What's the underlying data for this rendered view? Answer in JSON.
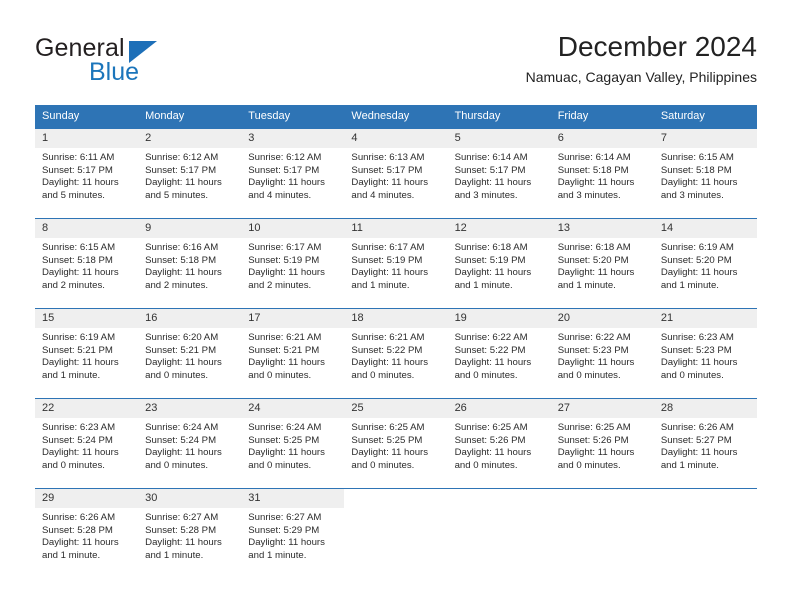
{
  "brand": {
    "name_part1": "General",
    "name_part2": "Blue",
    "triangle_color": "#1d6fb8",
    "blue_color": "#1b75bb"
  },
  "header": {
    "title": "December 2024",
    "subtitle": "Namuac, Cagayan Valley, Philippines"
  },
  "theme": {
    "header_bg": "#2e74b5",
    "daynum_bg": "#efefef",
    "row_rule": "#2e74b5"
  },
  "weekdays": [
    "Sunday",
    "Monday",
    "Tuesday",
    "Wednesday",
    "Thursday",
    "Friday",
    "Saturday"
  ],
  "labels": {
    "sunrise_prefix": "Sunrise:",
    "sunset_prefix": "Sunset:",
    "daylight_prefix": "Daylight:"
  },
  "weeks": [
    [
      {
        "day": "1",
        "sunrise": "Sunrise: 6:11 AM",
        "sunset": "Sunset: 5:17 PM",
        "daylight_line1": "Daylight: 11 hours",
        "daylight_line2": "and 5 minutes."
      },
      {
        "day": "2",
        "sunrise": "Sunrise: 6:12 AM",
        "sunset": "Sunset: 5:17 PM",
        "daylight_line1": "Daylight: 11 hours",
        "daylight_line2": "and 5 minutes."
      },
      {
        "day": "3",
        "sunrise": "Sunrise: 6:12 AM",
        "sunset": "Sunset: 5:17 PM",
        "daylight_line1": "Daylight: 11 hours",
        "daylight_line2": "and 4 minutes."
      },
      {
        "day": "4",
        "sunrise": "Sunrise: 6:13 AM",
        "sunset": "Sunset: 5:17 PM",
        "daylight_line1": "Daylight: 11 hours",
        "daylight_line2": "and 4 minutes."
      },
      {
        "day": "5",
        "sunrise": "Sunrise: 6:14 AM",
        "sunset": "Sunset: 5:17 PM",
        "daylight_line1": "Daylight: 11 hours",
        "daylight_line2": "and 3 minutes."
      },
      {
        "day": "6",
        "sunrise": "Sunrise: 6:14 AM",
        "sunset": "Sunset: 5:18 PM",
        "daylight_line1": "Daylight: 11 hours",
        "daylight_line2": "and 3 minutes."
      },
      {
        "day": "7",
        "sunrise": "Sunrise: 6:15 AM",
        "sunset": "Sunset: 5:18 PM",
        "daylight_line1": "Daylight: 11 hours",
        "daylight_line2": "and 3 minutes."
      }
    ],
    [
      {
        "day": "8",
        "sunrise": "Sunrise: 6:15 AM",
        "sunset": "Sunset: 5:18 PM",
        "daylight_line1": "Daylight: 11 hours",
        "daylight_line2": "and 2 minutes."
      },
      {
        "day": "9",
        "sunrise": "Sunrise: 6:16 AM",
        "sunset": "Sunset: 5:18 PM",
        "daylight_line1": "Daylight: 11 hours",
        "daylight_line2": "and 2 minutes."
      },
      {
        "day": "10",
        "sunrise": "Sunrise: 6:17 AM",
        "sunset": "Sunset: 5:19 PM",
        "daylight_line1": "Daylight: 11 hours",
        "daylight_line2": "and 2 minutes."
      },
      {
        "day": "11",
        "sunrise": "Sunrise: 6:17 AM",
        "sunset": "Sunset: 5:19 PM",
        "daylight_line1": "Daylight: 11 hours",
        "daylight_line2": "and 1 minute."
      },
      {
        "day": "12",
        "sunrise": "Sunrise: 6:18 AM",
        "sunset": "Sunset: 5:19 PM",
        "daylight_line1": "Daylight: 11 hours",
        "daylight_line2": "and 1 minute."
      },
      {
        "day": "13",
        "sunrise": "Sunrise: 6:18 AM",
        "sunset": "Sunset: 5:20 PM",
        "daylight_line1": "Daylight: 11 hours",
        "daylight_line2": "and 1 minute."
      },
      {
        "day": "14",
        "sunrise": "Sunrise: 6:19 AM",
        "sunset": "Sunset: 5:20 PM",
        "daylight_line1": "Daylight: 11 hours",
        "daylight_line2": "and 1 minute."
      }
    ],
    [
      {
        "day": "15",
        "sunrise": "Sunrise: 6:19 AM",
        "sunset": "Sunset: 5:21 PM",
        "daylight_line1": "Daylight: 11 hours",
        "daylight_line2": "and 1 minute."
      },
      {
        "day": "16",
        "sunrise": "Sunrise: 6:20 AM",
        "sunset": "Sunset: 5:21 PM",
        "daylight_line1": "Daylight: 11 hours",
        "daylight_line2": "and 0 minutes."
      },
      {
        "day": "17",
        "sunrise": "Sunrise: 6:21 AM",
        "sunset": "Sunset: 5:21 PM",
        "daylight_line1": "Daylight: 11 hours",
        "daylight_line2": "and 0 minutes."
      },
      {
        "day": "18",
        "sunrise": "Sunrise: 6:21 AM",
        "sunset": "Sunset: 5:22 PM",
        "daylight_line1": "Daylight: 11 hours",
        "daylight_line2": "and 0 minutes."
      },
      {
        "day": "19",
        "sunrise": "Sunrise: 6:22 AM",
        "sunset": "Sunset: 5:22 PM",
        "daylight_line1": "Daylight: 11 hours",
        "daylight_line2": "and 0 minutes."
      },
      {
        "day": "20",
        "sunrise": "Sunrise: 6:22 AM",
        "sunset": "Sunset: 5:23 PM",
        "daylight_line1": "Daylight: 11 hours",
        "daylight_line2": "and 0 minutes."
      },
      {
        "day": "21",
        "sunrise": "Sunrise: 6:23 AM",
        "sunset": "Sunset: 5:23 PM",
        "daylight_line1": "Daylight: 11 hours",
        "daylight_line2": "and 0 minutes."
      }
    ],
    [
      {
        "day": "22",
        "sunrise": "Sunrise: 6:23 AM",
        "sunset": "Sunset: 5:24 PM",
        "daylight_line1": "Daylight: 11 hours",
        "daylight_line2": "and 0 minutes."
      },
      {
        "day": "23",
        "sunrise": "Sunrise: 6:24 AM",
        "sunset": "Sunset: 5:24 PM",
        "daylight_line1": "Daylight: 11 hours",
        "daylight_line2": "and 0 minutes."
      },
      {
        "day": "24",
        "sunrise": "Sunrise: 6:24 AM",
        "sunset": "Sunset: 5:25 PM",
        "daylight_line1": "Daylight: 11 hours",
        "daylight_line2": "and 0 minutes."
      },
      {
        "day": "25",
        "sunrise": "Sunrise: 6:25 AM",
        "sunset": "Sunset: 5:25 PM",
        "daylight_line1": "Daylight: 11 hours",
        "daylight_line2": "and 0 minutes."
      },
      {
        "day": "26",
        "sunrise": "Sunrise: 6:25 AM",
        "sunset": "Sunset: 5:26 PM",
        "daylight_line1": "Daylight: 11 hours",
        "daylight_line2": "and 0 minutes."
      },
      {
        "day": "27",
        "sunrise": "Sunrise: 6:25 AM",
        "sunset": "Sunset: 5:26 PM",
        "daylight_line1": "Daylight: 11 hours",
        "daylight_line2": "and 0 minutes."
      },
      {
        "day": "28",
        "sunrise": "Sunrise: 6:26 AM",
        "sunset": "Sunset: 5:27 PM",
        "daylight_line1": "Daylight: 11 hours",
        "daylight_line2": "and 1 minute."
      }
    ],
    [
      {
        "day": "29",
        "sunrise": "Sunrise: 6:26 AM",
        "sunset": "Sunset: 5:28 PM",
        "daylight_line1": "Daylight: 11 hours",
        "daylight_line2": "and 1 minute."
      },
      {
        "day": "30",
        "sunrise": "Sunrise: 6:27 AM",
        "sunset": "Sunset: 5:28 PM",
        "daylight_line1": "Daylight: 11 hours",
        "daylight_line2": "and 1 minute."
      },
      {
        "day": "31",
        "sunrise": "Sunrise: 6:27 AM",
        "sunset": "Sunset: 5:29 PM",
        "daylight_line1": "Daylight: 11 hours",
        "daylight_line2": "and 1 minute."
      },
      {
        "day": "",
        "sunrise": "",
        "sunset": "",
        "daylight_line1": "",
        "daylight_line2": ""
      },
      {
        "day": "",
        "sunrise": "",
        "sunset": "",
        "daylight_line1": "",
        "daylight_line2": ""
      },
      {
        "day": "",
        "sunrise": "",
        "sunset": "",
        "daylight_line1": "",
        "daylight_line2": ""
      },
      {
        "day": "",
        "sunrise": "",
        "sunset": "",
        "daylight_line1": "",
        "daylight_line2": ""
      }
    ]
  ]
}
